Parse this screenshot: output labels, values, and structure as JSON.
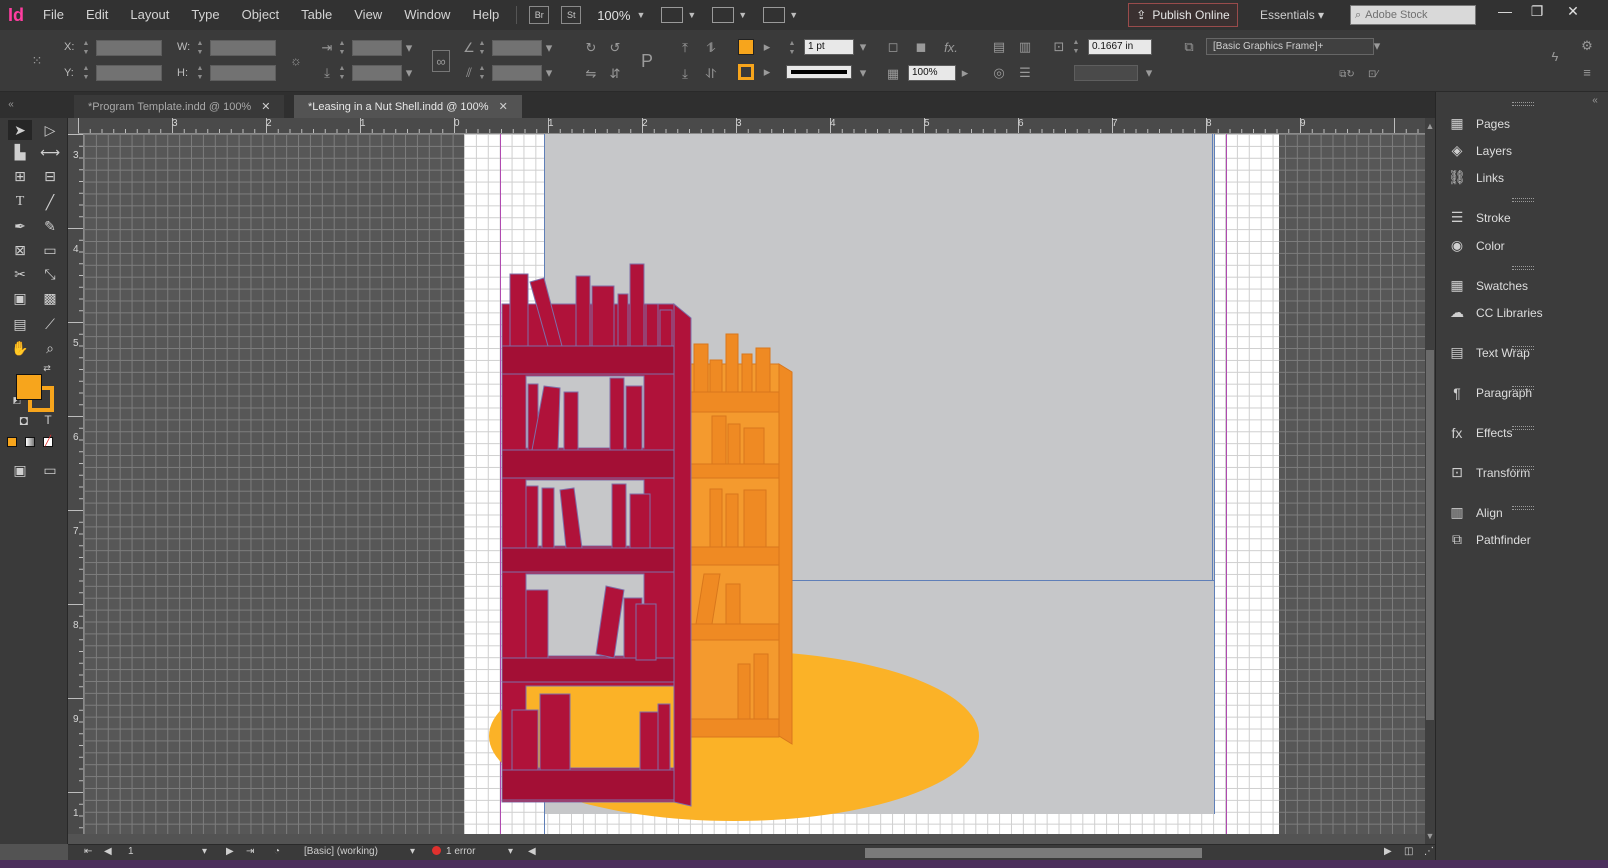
{
  "app": {
    "logo": "Id",
    "menu": [
      "File",
      "Edit",
      "Layout",
      "Type",
      "Object",
      "Table",
      "View",
      "Window",
      "Help"
    ],
    "bridge_label": "Br",
    "stock_label": "St",
    "zoom": "100%",
    "publish_label": "Publish Online",
    "workspace": "Essentials",
    "search_placeholder": "Adobe Stock"
  },
  "control_bar": {
    "x_label": "X:",
    "y_label": "Y:",
    "w_label": "W:",
    "h_label": "H:",
    "stroke_weight": "1 pt",
    "opacity": "100%",
    "offset": "0.1667 in",
    "object_style": "[Basic Graphics Frame]+",
    "fill_color": "#f7a51c"
  },
  "tabs": [
    {
      "label": "*Program Template.indd @ 100%",
      "active": false
    },
    {
      "label": "*Leasing in a Nut Shell.indd @ 100%",
      "active": true
    }
  ],
  "ruler": {
    "top": [
      "3",
      "2",
      "1",
      "0",
      "1",
      "2",
      "3",
      "4",
      "5",
      "6",
      "7",
      "8",
      "9"
    ],
    "left": [
      "3",
      "4",
      "5",
      "6",
      "7",
      "8",
      "9",
      "1"
    ]
  },
  "status": {
    "page": "1",
    "profile": "[Basic] (working)",
    "errors": "1 error"
  },
  "panels": [
    {
      "label": "Pages",
      "icon": "pages-icon"
    },
    {
      "label": "Layers",
      "icon": "layers-icon"
    },
    {
      "label": "Links",
      "icon": "links-icon"
    },
    {
      "label": "Stroke",
      "icon": "stroke-icon"
    },
    {
      "label": "Color",
      "icon": "color-icon"
    },
    {
      "label": "Swatches",
      "icon": "swatches-icon"
    },
    {
      "label": "CC Libraries",
      "icon": "cc-libraries-icon"
    },
    {
      "label": "Text Wrap",
      "icon": "text-wrap-icon"
    },
    {
      "label": "Paragraph",
      "icon": "paragraph-icon"
    },
    {
      "label": "Effects",
      "icon": "effects-icon"
    },
    {
      "label": "Transform",
      "icon": "transform-icon"
    },
    {
      "label": "Align",
      "icon": "align-icon"
    },
    {
      "label": "Pathfinder",
      "icon": "pathfinder-icon"
    }
  ],
  "colors": {
    "bookshelf_front": "#b0123a",
    "bookshelf_back": "#ef8a23",
    "ellipse": "#fbb227",
    "frame": "#c6c7c9"
  }
}
